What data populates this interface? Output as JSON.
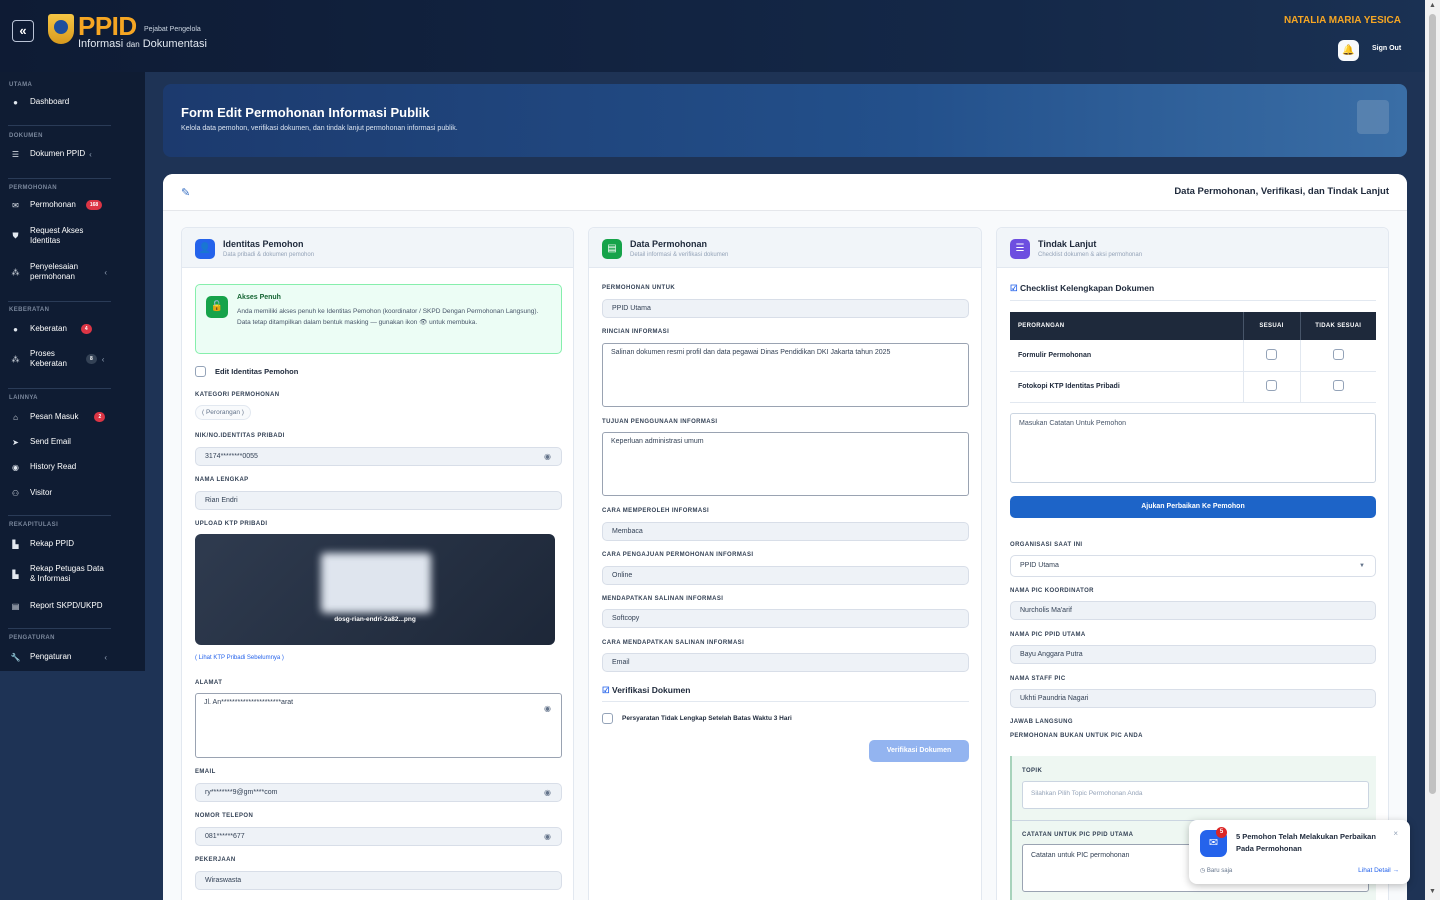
{
  "header": {
    "collapse_label": "«",
    "logo_main": "PPID",
    "logo_small": "Pejabat Pengelola",
    "logo_line_a": "Informasi",
    "logo_line_dan": "dan",
    "logo_line_b": "Dokumentasi",
    "user_name": "NATALIA MARIA YESICA",
    "signout_label": "Sign Out"
  },
  "sidebar": {
    "sections": {
      "utama": "UTAMA",
      "dokumen": "DOKUMEN",
      "permohonan": "PERMOHONAN",
      "keberatan": "KEBERATAN",
      "lainnya": "LAINNYA",
      "rekapitulasi": "REKAPITULASI",
      "pengaturan": "PENGATURAN"
    },
    "items": [
      {
        "label": "Dashboard",
        "icon": "dashboard-icon"
      },
      {
        "label": "Dokumen PPID",
        "icon": "list-icon"
      },
      {
        "label": "Permohonan",
        "icon": "mail-icon",
        "badge": "168"
      },
      {
        "label": "Request Akses Identitas",
        "icon": "shield-icon"
      },
      {
        "label": "Penyelesaian permohonan",
        "icon": "nodes-icon"
      },
      {
        "label": "Keberatan",
        "icon": "alert-icon",
        "badge": "4"
      },
      {
        "label": "Proses Keberatan",
        "icon": "nodes-icon",
        "badge": "8"
      },
      {
        "label": "Pesan Masuk",
        "icon": "inbox-icon",
        "badge": "2"
      },
      {
        "label": "Send Email",
        "icon": "send-icon"
      },
      {
        "label": "History Read",
        "icon": "eye-icon"
      },
      {
        "label": "Visitor",
        "icon": "users-icon"
      },
      {
        "label": "Rekap PPID",
        "icon": "chart-icon"
      },
      {
        "label": "Rekap Petugas Data & Informasi",
        "icon": "chart-icon"
      },
      {
        "label": "Report SKPD/UKPD",
        "icon": "file-icon"
      },
      {
        "label": "Pengaturan",
        "icon": "wrench-icon"
      }
    ]
  },
  "hero": {
    "title": "Form Edit Permohonan Informasi Publik",
    "subtitle": "Kelola data pemohon, verifikasi dokumen, dan tindak lanjut permohonan informasi publik."
  },
  "card": {
    "title": "Data Permohonan, Verifikasi, dan Tindak Lanjut"
  },
  "identitas": {
    "title": "Identitas Pemohon",
    "subtitle": "Data pribadi & dokumen pemohon",
    "alert_title": "Akses Penuh",
    "alert_text": "Anda memiliki akses penuh ke Identitas Pemohon (koordinator / SKPD Dengan Permohonan Langsung). Data tetap ditampilkan dalam bentuk masking — gunakan ikon 👁 untuk membuka.",
    "edit_label": "Edit Identitas Pemohon",
    "kategori_label": "KATEGORI PERMOHONAN",
    "kategori_value": "( Perorangan )",
    "nik_label": "NIK/NO.IDENTITAS PRIBADI",
    "nik_value": "3174********0055",
    "nama_label": "NAMA LENGKAP",
    "nama_value": "Rian Endri",
    "ktp_label": "UPLOAD KTP PRIBADI",
    "ktp_file": "dosg-rian-endri-2a82...png",
    "ktp_link": "( Lihat KTP Pribadi Sebelumnya )",
    "alamat_label": "ALAMAT",
    "alamat_value": "Jl. An**********************arat",
    "email_label": "EMAIL",
    "email_value": "ry********9@gm****com",
    "telp_label": "NOMOR TELEPON",
    "telp_value": "081******677",
    "pekerjaan_label": "PEKERJAAN",
    "pekerjaan_value": "Wiraswasta"
  },
  "permohonan": {
    "title": "Data Permohonan",
    "subtitle": "Detail informasi & verifikasi dokumen",
    "untuk_label": "PERMOHONAN UNTUK",
    "untuk_value": "PPID Utama",
    "rincian_label": "RINCIAN INFORMASI",
    "rincian_value": "Salinan dokumen resmi profil dan data pegawai Dinas Pendidikan DKI Jakarta tahun 2025",
    "tujuan_label": "TUJUAN PENGGUNAAN INFORMASI",
    "tujuan_value": "Keperluan administrasi umum",
    "cara_label": "CARA MEMPEROLEH INFORMASI",
    "cara_value": "Membaca",
    "pengajuan_label": "CARA PENGAJUAN PERMOHONAN INFORMASI",
    "pengajuan_value": "Online",
    "salinan_label": "MENDAPATKAN SALINAN INFORMASI",
    "salinan_value": "Softcopy",
    "cara_salinan_label": "CARA MENDAPATKAN SALINAN INFORMASI",
    "cara_salinan_value": "Email",
    "verif_title": "Verifikasi Dokumen",
    "verif_check": "Persyaratan Tidak Lengkap Setelah Batas Waktu 3 Hari",
    "verif_button": "Verifikasi Dokumen"
  },
  "tindak": {
    "title": "Tindak Lanjut",
    "subtitle": "Checklist dokumen & aksi permohonan",
    "checklist_title": "Checklist Kelengkapan Dokumen",
    "table_headers": [
      "PERORANGAN",
      "SESUAI",
      "TIDAK SESUAI"
    ],
    "table_rows": [
      "Formulir Permohonan",
      "Fotokopi KTP Identitas Pribadi"
    ],
    "catatan_placeholder": "Masukan Catatan Untuk Pemohon",
    "ajukan_button": "Ajukan Perbaikan Ke Pemohon",
    "org_label": "ORGANISASI SAAT INI",
    "org_value": "PPID Utama",
    "pic_koord_label": "NAMA PIC KOORDINATOR",
    "pic_koord_value": "Nurcholis Ma'arif",
    "pic_utama_label": "NAMA PIC PPID UTAMA",
    "pic_utama_value": "Bayu Anggara Putra",
    "staff_label": "NAMA STAFF PIC",
    "staff_value": "Ukhti Paundria Nagari",
    "jawab_label": "JAWAB LANGSUNG",
    "bukan_label": "PERMOHONAN BUKAN UNTUK PIC ANDA",
    "topik_label": "TOPIK",
    "topik_placeholder": "Silahkan Pilih Topic Permohonan Anda",
    "catatan_pic_label": "CATATAN UNTUK PIC PPID UTAMA",
    "catatan_pic_placeholder": "Catatan untuk PIC permohonan"
  },
  "toast": {
    "badge": "5",
    "title": "5 Pemohon Telah Melakukan Perbaikan Pada Permohonan",
    "time": "Baru saja",
    "detail": "Lihat Detail →",
    "close": "×"
  },
  "colors": {
    "accent": "#f6a623",
    "primary": "#2563eb",
    "danger": "#dc3545",
    "success": "#16a34a"
  }
}
